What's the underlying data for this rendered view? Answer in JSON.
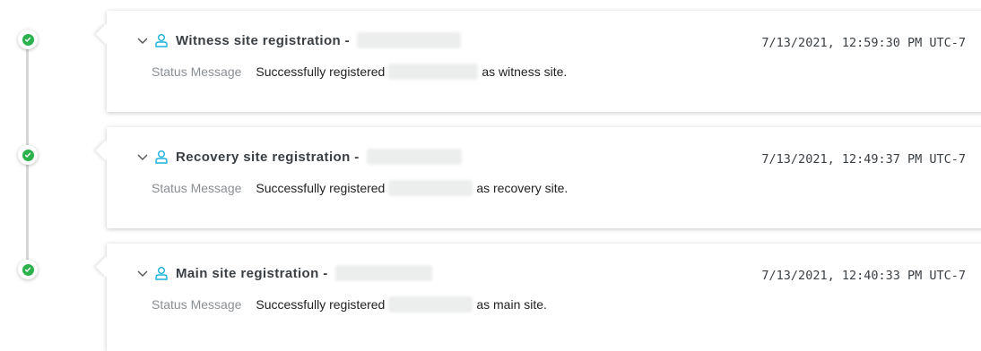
{
  "events": [
    {
      "title": "Witness site registration -",
      "timestamp": "7/13/2021, 12:59:30 PM UTC-7",
      "status_label": "Status Message",
      "status_prefix": "Successfully registered",
      "status_suffix": "as witness site."
    },
    {
      "title": "Recovery site registration -",
      "timestamp": "7/13/2021, 12:49:37 PM UTC-7",
      "status_label": "Status Message",
      "status_prefix": "Successfully registered",
      "status_suffix": "as recovery site."
    },
    {
      "title": "Main site registration -",
      "timestamp": "7/13/2021, 12:40:33 PM UTC-7",
      "status_label": "Status Message",
      "status_prefix": "Successfully registered",
      "status_suffix": "as main site."
    }
  ],
  "colors": {
    "success": "#2bb24c",
    "user_icon": "#1ab0d8",
    "redacted": "#eceded"
  },
  "icons": {
    "status": "check-circle-icon",
    "expand": "chevron-down-icon",
    "user": "user-icon"
  }
}
